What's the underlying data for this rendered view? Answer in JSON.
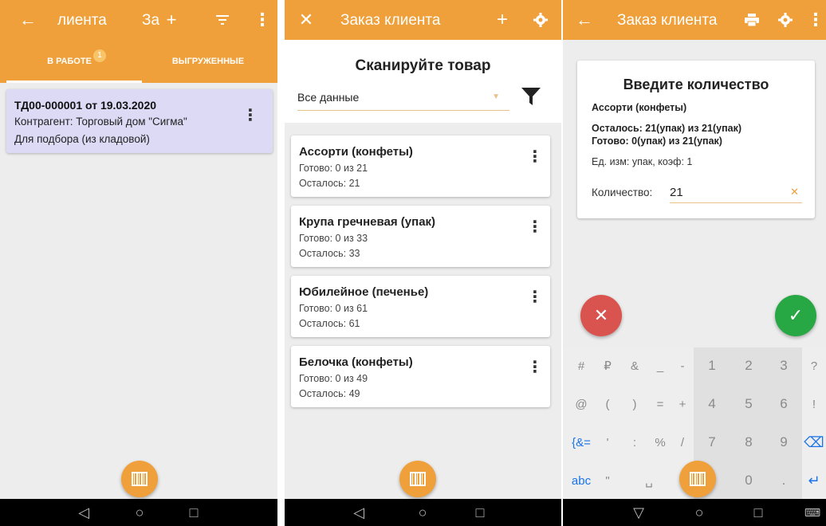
{
  "screen1": {
    "title": "лиента",
    "title_part2": "За",
    "icons": {
      "back": "arrow-left-icon",
      "add": "plus-icon",
      "filter": "filter-icon",
      "menu": "more-vert-icon"
    },
    "tabs": [
      {
        "label": "В РАБОТЕ",
        "badge": "1"
      },
      {
        "label": "ВЫГРУЖЕННЫЕ"
      }
    ],
    "order": {
      "title": "ТД00-000001 от 19.03.2020",
      "counterparty": "Контрагент: Торговый дом \"Сигма\"",
      "purpose": "Для подбора (из кладовой)"
    }
  },
  "screen2": {
    "title": "Заказ клиента",
    "icons": {
      "close": "close-icon",
      "add": "plus-icon",
      "settings": "gear-icon",
      "filter": "filter-icon"
    },
    "heading": "Сканируйте товар",
    "select_value": "Все данные",
    "items": [
      {
        "name": "Ассорти (конфеты)",
        "done": "Готово: 0 из 21",
        "left": "Осталось: 21"
      },
      {
        "name": "Крупа гречневая (упак)",
        "done": "Готово: 0 из 33",
        "left": "Осталось: 33"
      },
      {
        "name": "Юбилейное (печенье)",
        "done": "Готово: 0 из 61",
        "left": "Осталось: 61"
      },
      {
        "name": "Белочка (конфеты)",
        "done": "Готово: 0 из 49",
        "left": "Осталось: 49"
      }
    ]
  },
  "screen3": {
    "title": "Заказ клиента",
    "icons": {
      "back": "arrow-left-icon",
      "print": "printer-icon",
      "settings": "gear-icon",
      "menu": "more-vert-icon"
    },
    "dialog": {
      "title": "Введите количество",
      "product": "Ассорти (конфеты)",
      "left": "Осталось: 21(упак) из 21(упак)",
      "done": "Готово: 0(упак) из 21(упак)",
      "unit": "Ед. изм: упак, коэф: 1",
      "qty_label": "Количество:",
      "qty_value": "21"
    },
    "keyboard": {
      "row1": [
        "#",
        "₽",
        "&",
        "_",
        "-",
        "1",
        "2",
        "3",
        "?"
      ],
      "row2": [
        "@",
        "(",
        ")",
        "=",
        "+",
        "4",
        "5",
        "6",
        "!"
      ],
      "row3": [
        "{&=",
        "'",
        ":",
        "%",
        "/",
        "7",
        "8",
        "9",
        "⌫"
      ],
      "row4": [
        "abc",
        "\"",
        "␣",
        "",
        "0",
        ".",
        "↵"
      ]
    }
  },
  "colors": {
    "accent": "#f0a03a",
    "cancel": "#d9534f",
    "confirm": "#28a745",
    "tab_card": "#dcdaf5"
  }
}
